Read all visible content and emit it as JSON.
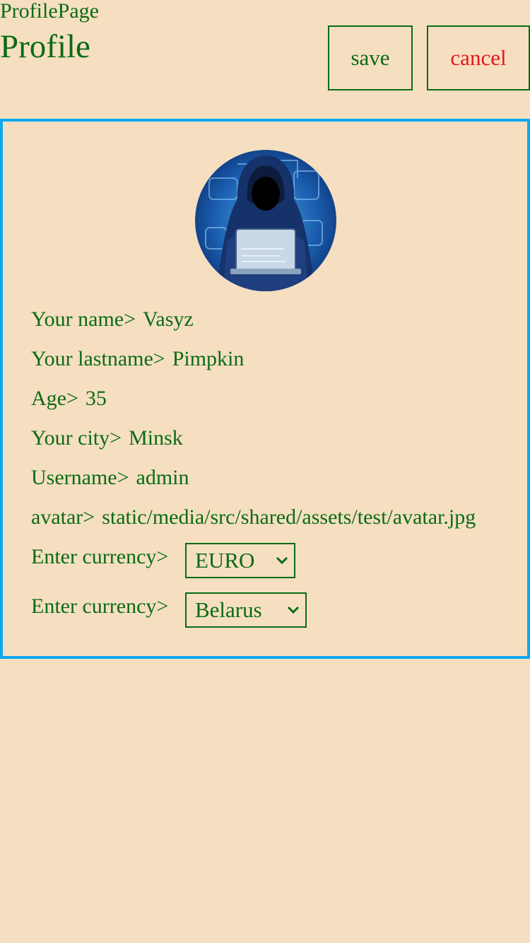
{
  "header": {
    "page_label": "ProfilePage",
    "title": "Profile",
    "save_label": "save",
    "cancel_label": "cancel"
  },
  "profile": {
    "avatar_icon": "hooded-hacker-avatar",
    "fields": {
      "name_label": "Your name>",
      "name_value": "Vasyz",
      "lastname_label": "Your lastname>",
      "lastname_value": "Pimpkin",
      "age_label": "Age>",
      "age_value": "35",
      "city_label": "Your city>",
      "city_value": "Minsk",
      "username_label": "Username>",
      "username_value": "admin",
      "avatar_label": "avatar>",
      "avatar_value": "static/media/src/shared/assets/test/avatar.jpg"
    },
    "currency": {
      "label": "Enter currency>",
      "selected": "EURO"
    },
    "country": {
      "label": "Enter currency>",
      "selected": "Belarus"
    }
  },
  "colors": {
    "background": "#f5dfc0",
    "text": "#0b6b14",
    "cancel": "#e8141c",
    "card_border": "#10a8f0"
  }
}
